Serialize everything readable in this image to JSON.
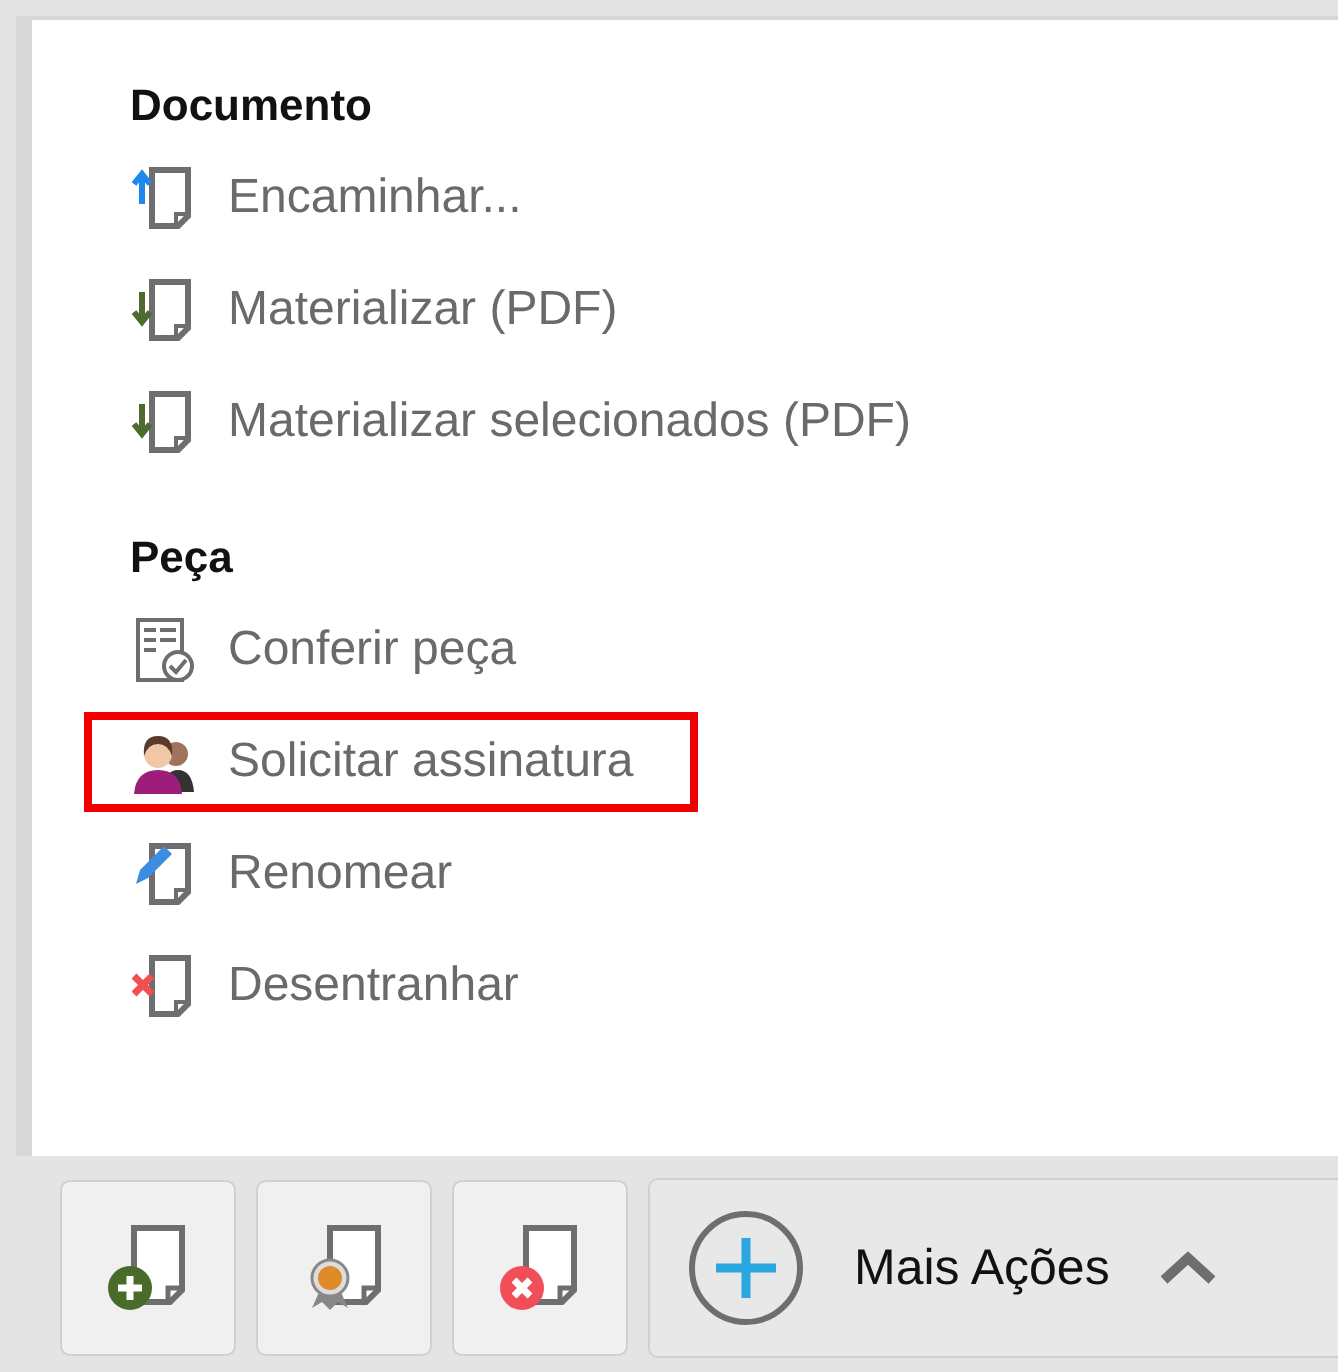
{
  "menu": {
    "sections": [
      {
        "heading": "Documento",
        "items": [
          {
            "kind": "forward",
            "label": "Encaminhar...",
            "highlighted": false
          },
          {
            "kind": "download",
            "label": "Materializar (PDF)",
            "highlighted": false
          },
          {
            "kind": "download",
            "label": "Materializar selecionados (PDF)",
            "highlighted": false
          }
        ]
      },
      {
        "heading": "Peça",
        "items": [
          {
            "kind": "check",
            "label": "Conferir peça",
            "highlighted": false
          },
          {
            "kind": "people",
            "label": "Solicitar assinatura",
            "highlighted": true
          },
          {
            "kind": "rename",
            "label": "Renomear",
            "highlighted": false
          },
          {
            "kind": "remove",
            "label": "Desentranhar",
            "highlighted": false
          }
        ]
      }
    ]
  },
  "toolbar": {
    "buttons": [
      {
        "kind": "add"
      },
      {
        "kind": "certify"
      },
      {
        "kind": "delete"
      }
    ],
    "more_button": {
      "label": "Mais Ações",
      "expanded": true
    }
  }
}
